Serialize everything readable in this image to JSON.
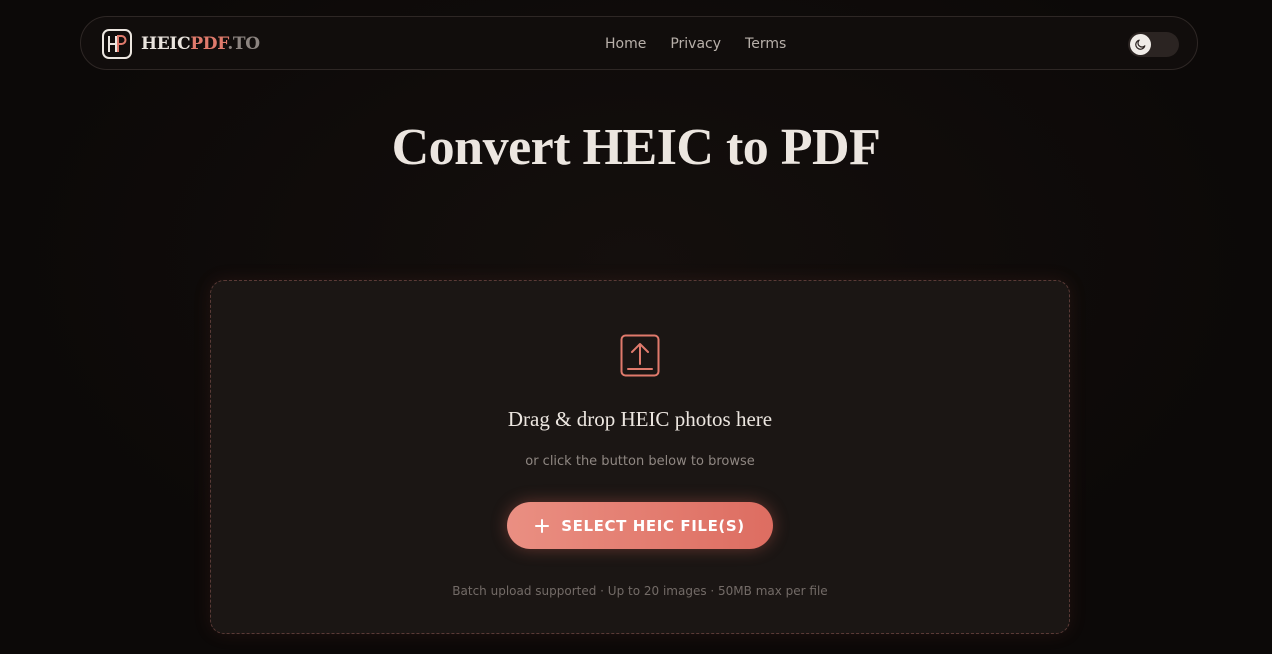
{
  "nav": {
    "logo": {
      "icon": "hp-logo-icon",
      "part_heic": "HEIC",
      "part_pdf": "PDF",
      "part_to": ".TO"
    },
    "links": [
      "Home",
      "Privacy",
      "Terms"
    ],
    "theme_toggle": {
      "icon": "moon-icon",
      "state": "dark"
    }
  },
  "hero": {
    "title": "Convert HEIC to PDF"
  },
  "upload": {
    "icon": "upload-icon",
    "title": "Drag & drop HEIC photos here",
    "subtitle": "or click the button below to browse",
    "button_label": "SELECT HEIC FILE(S)",
    "button_icon": "plus-icon",
    "note": "Batch upload supported · Up to 20 images · 50MB max per file"
  },
  "colors": {
    "accent": "#e07a6c",
    "background": "#0e0a09",
    "panel": "#1b1614"
  }
}
